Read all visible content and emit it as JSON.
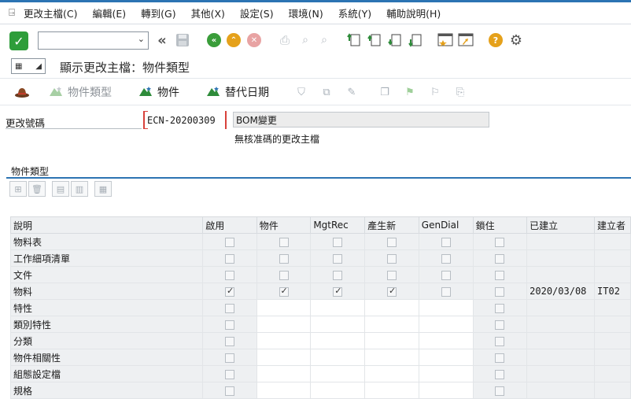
{
  "menu": {
    "items": [
      "更改主檔(C)",
      "編輯(E)",
      "轉到(G)",
      "其他(X)",
      "設定(S)",
      "環境(N)",
      "系統(Y)",
      "輔助說明(H)"
    ]
  },
  "toolbar": {
    "command_value": "",
    "arrow": "⌄"
  },
  "title": {
    "text": "顯示更改主檔：物件類型"
  },
  "app_toolbar": {
    "object_types_label": "物件類型",
    "objects_label": "物件",
    "alt_dates_label": "替代日期"
  },
  "header": {
    "change_number_label": "更改號碼",
    "change_number_value": "ECN-20200309",
    "description": "BOM變更",
    "subtext": "無核准碼的更改主檔"
  },
  "section": {
    "title": "物件類型"
  },
  "table": {
    "columns": [
      "說明",
      "啟用",
      "物件",
      "MgtRec",
      "產生新",
      "GenDial",
      "鎖住",
      "已建立",
      "建立者"
    ],
    "rows": [
      {
        "label": "物料表",
        "checks": [
          false,
          false,
          false,
          false,
          false,
          false
        ],
        "created": "",
        "creator": "",
        "editable": false
      },
      {
        "label": "工作細項清單",
        "checks": [
          false,
          false,
          false,
          false,
          false,
          false
        ],
        "created": "",
        "creator": "",
        "editable": false
      },
      {
        "label": "文件",
        "checks": [
          false,
          false,
          false,
          false,
          false,
          false
        ],
        "created": "",
        "creator": "",
        "editable": false
      },
      {
        "label": "物料",
        "checks": [
          true,
          true,
          true,
          true,
          false,
          false
        ],
        "created": "2020/03/08",
        "creator": "IT02",
        "editable": false
      },
      {
        "label": "特性",
        "checks": [
          false,
          null,
          null,
          null,
          null,
          false
        ],
        "created": "",
        "creator": "",
        "editable": true
      },
      {
        "label": "類別特性",
        "checks": [
          false,
          null,
          null,
          null,
          null,
          false
        ],
        "created": "",
        "creator": "",
        "editable": true
      },
      {
        "label": "分類",
        "checks": [
          false,
          null,
          null,
          null,
          null,
          false
        ],
        "created": "",
        "creator": "",
        "editable": true
      },
      {
        "label": "物件相關性",
        "checks": [
          false,
          null,
          null,
          null,
          null,
          false
        ],
        "created": "",
        "creator": "",
        "editable": true
      },
      {
        "label": "組態設定檔",
        "checks": [
          false,
          null,
          null,
          null,
          null,
          false
        ],
        "created": "",
        "creator": "",
        "editable": true
      },
      {
        "label": "規格",
        "checks": [
          false,
          null,
          null,
          null,
          null,
          false
        ],
        "created": "",
        "creator": "",
        "editable": true
      }
    ]
  }
}
